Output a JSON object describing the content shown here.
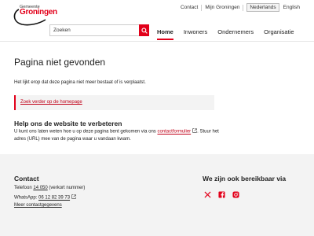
{
  "topbar": {
    "contact": "Contact",
    "my": "Mijn Groningen",
    "lang_nl": "Nederlands",
    "lang_en": "English"
  },
  "logo": {
    "line1": "Gemeente",
    "line2": "Groningen"
  },
  "search": {
    "placeholder": "Zoeken"
  },
  "nav": {
    "home": "Home",
    "inwoners": "Inwoners",
    "ondernemers": "Ondernemers",
    "organisatie": "Organisatie"
  },
  "main": {
    "title": "Pagina niet gevonden",
    "intro": "Het lijkt erop dat deze pagina niet meer bestaat of is verplaatst.",
    "link": "Zoek verder op de homepage",
    "help_title": "Help ons de website te verbeteren",
    "help_text_before": "U kunt ons laten weten hoe u op deze pagina bent gekomen via ons ",
    "help_link": "contactformulier",
    "help_text_after": ". Stuur het adres (URL) mee van de pagina waar u vandaan kwam."
  },
  "footer": {
    "contact_title": "Contact",
    "phone_label": "Telefoon ",
    "phone_number": "14 050",
    "phone_note": " (verkort nummer)",
    "whatsapp_label": "WhatsApp: ",
    "whatsapp_number": "06 12 82 39 73",
    "more": "Meer contactgegevens",
    "reach_title": "We zijn ook bereikbaar via"
  },
  "colors": {
    "brand": "#e2001a"
  }
}
